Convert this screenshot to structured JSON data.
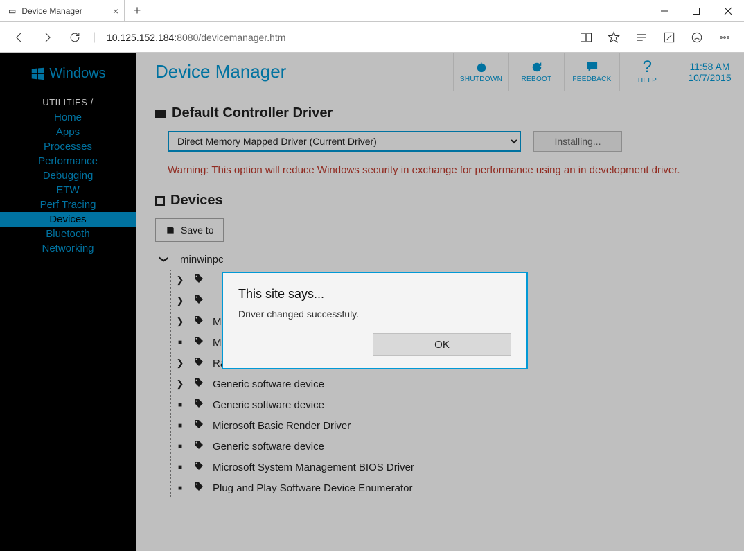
{
  "browser": {
    "tab_title": "Device Manager",
    "url_host": "10.125.152.184",
    "url_rest": ":8080/devicemanager.htm"
  },
  "sidebar": {
    "brand": "Windows",
    "heading": "UTILITIES /",
    "items": [
      "Home",
      "Apps",
      "Processes",
      "Performance",
      "Debugging",
      "ETW",
      "Perf Tracing",
      "Devices",
      "Bluetooth",
      "Networking"
    ],
    "active_index": 7
  },
  "header": {
    "title": "Device Manager",
    "actions": {
      "shutdown": "SHUTDOWN",
      "reboot": "REBOOT",
      "feedback": "FEEDBACK",
      "help": "HELP"
    },
    "time": "11:58 AM",
    "date": "10/7/2015"
  },
  "driver_section": {
    "title": "Default Controller Driver",
    "selected": "Direct Memory Mapped Driver (Current Driver)",
    "install_label": "Installing...",
    "warning": "Warning: This option will reduce Windows security in exchange for performance using an in development driver."
  },
  "devices_section": {
    "title": "Devices",
    "save_label": "Save to",
    "root": "minwinpc",
    "items": [
      {
        "marker": "chevron",
        "label": ""
      },
      {
        "marker": "chevron",
        "label": ""
      },
      {
        "marker": "chevron",
        "label": "Microsoft Basic Display Driver"
      },
      {
        "marker": "bullet",
        "label": "Microsoft Kernel Debug Network Adapter"
      },
      {
        "marker": "chevron",
        "label": "Raspberry Pi 2 audio"
      },
      {
        "marker": "chevron",
        "label": "Generic software device"
      },
      {
        "marker": "bullet",
        "label": "Generic software device"
      },
      {
        "marker": "bullet",
        "label": "Microsoft Basic Render Driver"
      },
      {
        "marker": "bullet",
        "label": "Generic software device"
      },
      {
        "marker": "bullet",
        "label": "Microsoft System Management BIOS Driver"
      },
      {
        "marker": "bullet",
        "label": "Plug and Play Software Device Enumerator"
      }
    ]
  },
  "dialog": {
    "title": "This site says...",
    "message": "Driver changed successfuly.",
    "ok": "OK"
  }
}
